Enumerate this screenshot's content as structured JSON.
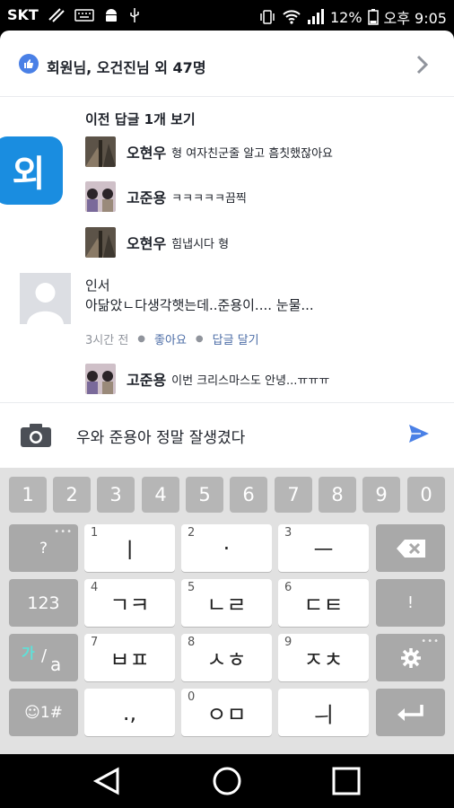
{
  "status_bar": {
    "carrier": "SKT",
    "battery": "12%",
    "time": "오후 9:05"
  },
  "likes": {
    "text": "회원님, 오건진님 외 47명"
  },
  "external_app": {
    "label": "외"
  },
  "thread": {
    "previous_link": "이전 답글 1개 보기",
    "replies": [
      {
        "name": "오현우",
        "message": "형 여자친군줄 알고 흠칫했잖아요"
      },
      {
        "name": "고준용",
        "message": "ㅋㅋㅋㅋㅋ끔찍"
      },
      {
        "name": "오현우",
        "message": "힘냅시다 형"
      }
    ],
    "comment": {
      "name": "인서",
      "text": "아닮았ㄴ다생각햇는데..준용이.... 눈물...",
      "time": "3시간 전",
      "like": "좋아요",
      "reply": "답글 달기"
    },
    "last_reply": {
      "name": "고준용",
      "message": "이번 크리스마스도 안녕...ㅠㅠㅠ"
    }
  },
  "composer": {
    "text": "우와 준용아 정말 잘생겼다"
  },
  "keyboard": {
    "numbers": [
      "1",
      "2",
      "3",
      "4",
      "5",
      "6",
      "7",
      "8",
      "9",
      "0"
    ],
    "row1": {
      "left": "?",
      "keys": [
        {
          "n": "1",
          "t": "ㅣ"
        },
        {
          "n": "2",
          "t": "·"
        },
        {
          "n": "3",
          "t": "ㅡ"
        }
      ]
    },
    "row2": {
      "left": "123",
      "keys": [
        {
          "n": "4",
          "t": "ㄱㅋ"
        },
        {
          "n": "5",
          "t": "ㄴㄹ"
        },
        {
          "n": "6",
          "t": "ㄷㅌ"
        }
      ],
      "right": "!"
    },
    "row3": {
      "left_top": "가",
      "left_bottom": "a",
      "keys": [
        {
          "n": "7",
          "t": "ㅂㅍ"
        },
        {
          "n": "8",
          "t": "ㅅㅎ"
        },
        {
          "n": "9",
          "t": "ㅈㅊ"
        }
      ]
    },
    "row4": {
      "left": "☺1#",
      "keys": [
        {
          "n": "",
          "t": ".,"
        },
        {
          "n": "0",
          "t": "ㅇㅁ"
        },
        {
          "n": "",
          "t": "ㅢ"
        }
      ]
    }
  }
}
